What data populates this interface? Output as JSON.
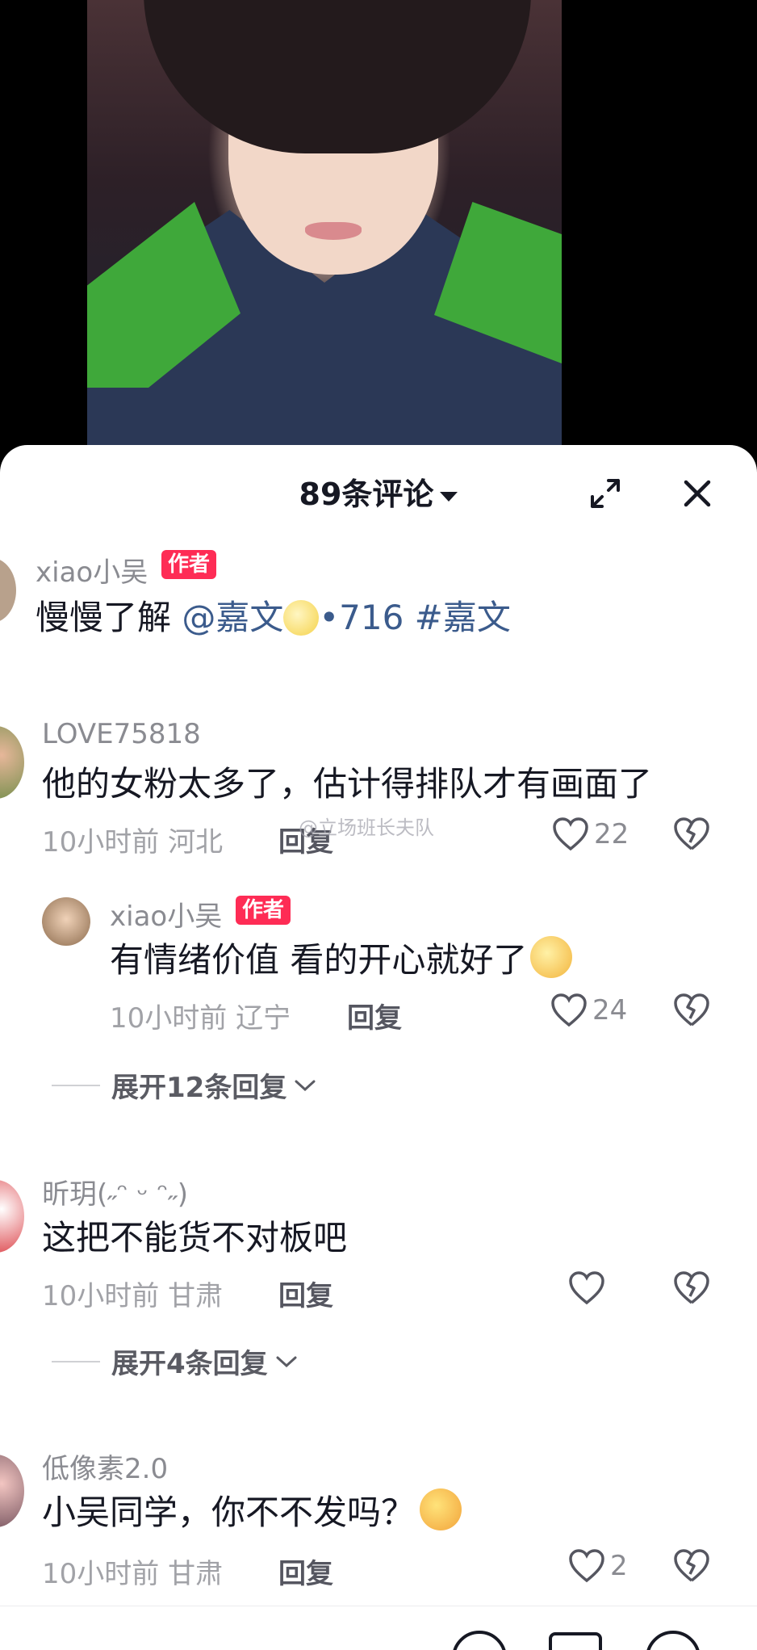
{
  "header": {
    "title": "89条评论"
  },
  "comments": [
    {
      "user": "xiao小吴",
      "badge": "作者",
      "text_plain": "慢慢了解 ",
      "mention": "@嘉文",
      "text_tail": "•716 #嘉文"
    },
    {
      "user": "LOVE75818",
      "text": "他的女粉太多了，估计得排队才有画面了",
      "time_loc": "10小时前 河北",
      "reply_label": "回复",
      "likes": "22",
      "replies": [
        {
          "user": "xiao小吴",
          "badge": "作者",
          "text": "有情绪价值 看的开心就好了",
          "time_loc": "10小时前 辽宁",
          "reply_label": "回复",
          "likes": "24"
        }
      ],
      "expand_label": "展开12条回复"
    },
    {
      "user": "昕玥(˶ᵔ ᵕ ᵔ˶)",
      "text": "这把不能货不对板吧",
      "time_loc": "10小时前 甘肃",
      "reply_label": "回复",
      "likes": "",
      "expand_label": "展开4条回复"
    },
    {
      "user": "低像素2.0",
      "text": "小吴同学，你不不发吗？",
      "time_loc": "10小时前 甘肃",
      "reply_label": "回复",
      "likes": "2"
    }
  ],
  "watermark": "@立场班长夫队",
  "colors": {
    "badge": "#fe2c55",
    "mention": "#3b5b8c",
    "text": "#161823",
    "meta": "#a1a2a7"
  },
  "icons": {
    "expand": "expand-icon",
    "close": "close-icon",
    "like": "heart-icon",
    "dislike": "broken-heart-icon",
    "chevron": "chevron-down-icon"
  }
}
